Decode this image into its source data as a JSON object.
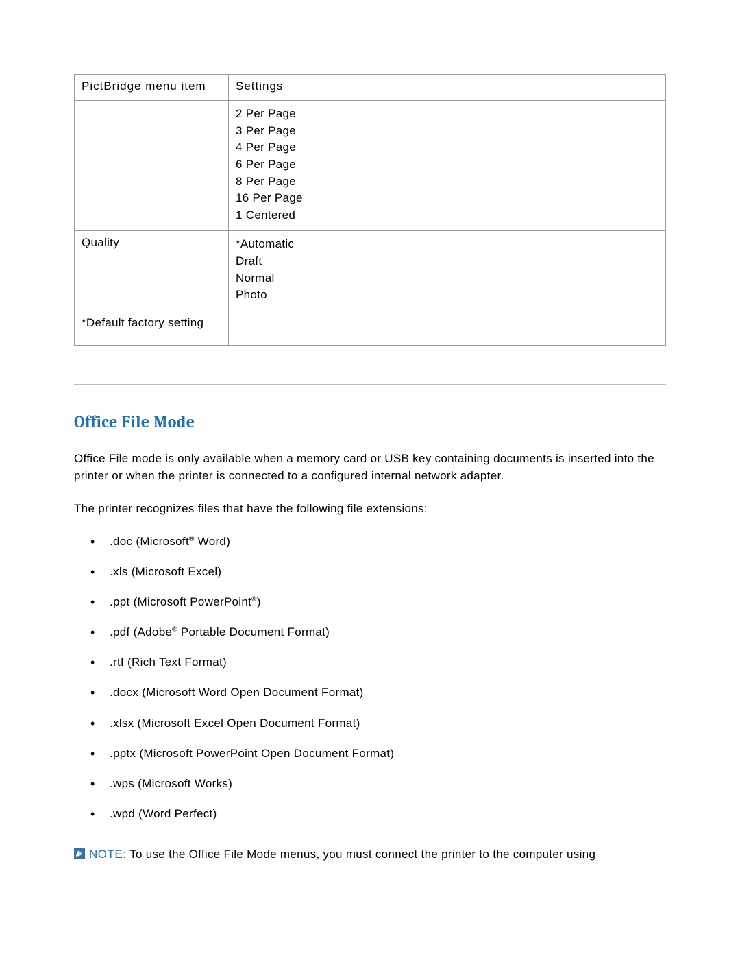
{
  "table": {
    "headers": {
      "menu_item": "PictBridge menu item",
      "settings": "Settings"
    },
    "rows": [
      {
        "menu_item": "",
        "settings": [
          "2 Per Page",
          "3 Per Page",
          "4 Per Page",
          "6 Per Page",
          "8 Per Page",
          "16 Per Page",
          "1 Centered"
        ]
      },
      {
        "menu_item": "Quality",
        "settings": [
          "*Automatic",
          "Draft",
          "Normal",
          "Photo"
        ]
      },
      {
        "menu_item": "*Default factory setting",
        "settings": []
      }
    ]
  },
  "section": {
    "title": "Office File Mode",
    "para1": "Office File mode is only available when a memory card or USB key containing documents is inserted into the printer or when the printer is connected to a configured internal network adapter.",
    "para2": "The printer recognizes files that have the following file extensions:",
    "extensions": [
      {
        "pre": ".doc (Microsoft",
        "sup": "®",
        "post": " Word)"
      },
      {
        "pre": ".xls (Microsoft Excel)",
        "sup": "",
        "post": ""
      },
      {
        "pre": ".ppt (Microsoft PowerPoint",
        "sup": "®",
        "post": ")"
      },
      {
        "pre": ".pdf (Adobe",
        "sup": "®",
        "post": " Portable Document Format)"
      },
      {
        "pre": ".rtf (Rich Text Format)",
        "sup": "",
        "post": ""
      },
      {
        "pre": ".docx (Microsoft Word Open Document Format)",
        "sup": "",
        "post": ""
      },
      {
        "pre": ".xlsx (Microsoft Excel Open Document Format)",
        "sup": "",
        "post": ""
      },
      {
        "pre": ".pptx (Microsoft PowerPoint Open Document Format)",
        "sup": "",
        "post": ""
      },
      {
        "pre": ".wps (Microsoft Works)",
        "sup": "",
        "post": ""
      },
      {
        "pre": ".wpd (Word Perfect)",
        "sup": "",
        "post": ""
      }
    ],
    "note_prefix": "NOTE:",
    "note_body": " To use the Office File Mode menus, you must connect the printer to the computer using"
  }
}
